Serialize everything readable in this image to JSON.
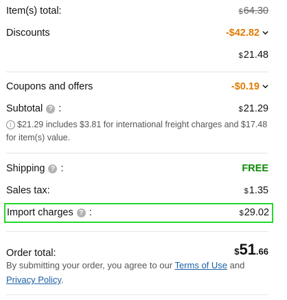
{
  "summary": {
    "items_total": {
      "label": "Item(s) total:",
      "currency": "$",
      "amount": "64.30"
    },
    "discounts": {
      "label": "Discounts",
      "value": "-$42.82"
    },
    "after_discount": {
      "currency": "$",
      "amount": "21.48"
    },
    "coupons": {
      "label": "Coupons and offers",
      "value": "-$0.19"
    },
    "subtotal": {
      "label": "Subtotal",
      "colon": ":",
      "currency": "$",
      "amount": "21.29"
    },
    "subtotal_note": {
      "icon": "i",
      "text": "$21.29 includes $3.81 for international freight charges and $17.48 for item(s) value."
    },
    "shipping": {
      "label": "Shipping",
      "colon": ":",
      "value": "FREE"
    },
    "sales_tax": {
      "label": "Sales tax:",
      "currency": "$",
      "amount": "1.35"
    },
    "import_charges": {
      "label": "Import charges",
      "colon": ":",
      "currency": "$",
      "amount": "29.02"
    },
    "order_total": {
      "label": "Order total:",
      "currency": "$",
      "whole": "51",
      "cents": ".66"
    },
    "agreement": {
      "prefix": "By submitting your order, you agree to our ",
      "terms_link": "Terms of Use",
      "middle": " and",
      "privacy_link": "Privacy Policy",
      "suffix": "."
    }
  },
  "icons": {
    "help": "?",
    "chevron": "chevron-down-icon",
    "info": "info-icon"
  },
  "colors": {
    "discount": "#e07b00",
    "free": "#0b8a00",
    "highlight": "#22d72b",
    "link": "#1a5fa8"
  }
}
